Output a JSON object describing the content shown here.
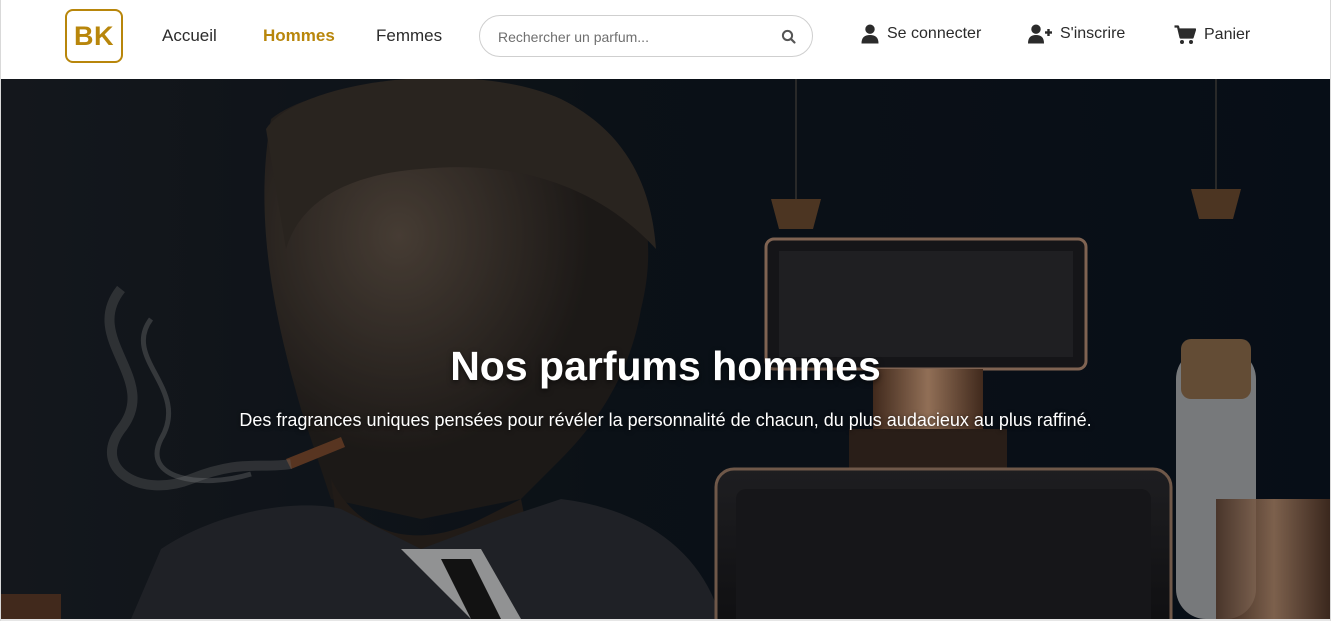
{
  "brand": {
    "logo_text": "BK",
    "accent_color": "#b8860b"
  },
  "nav": {
    "links": [
      {
        "label": "Accueil",
        "active": false
      },
      {
        "label": "Hommes",
        "active": true
      },
      {
        "label": "Femmes",
        "active": false
      }
    ]
  },
  "search": {
    "placeholder": "Rechercher un parfum...",
    "value": "",
    "icon": "search-icon"
  },
  "actions": {
    "login": {
      "label": "Se connecter",
      "icon": "user-icon"
    },
    "register": {
      "label": "S'inscrire",
      "icon": "user-plus-icon"
    },
    "cart": {
      "label": "Panier",
      "icon": "cart-icon"
    }
  },
  "hero": {
    "title": "Nos parfums hommes",
    "subtitle": "Des fragrances uniques pensées pour révéler la personnalité de chacun, du plus audacieux au plus raffiné."
  }
}
